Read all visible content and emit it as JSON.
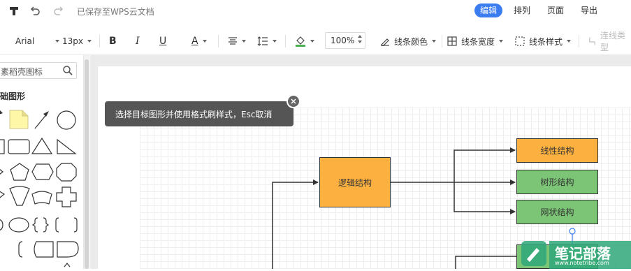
{
  "topbar": {
    "saved_status": "已保存至WPS云文档",
    "tabs": [
      {
        "label": "编辑",
        "active": true
      },
      {
        "label": "排列",
        "active": false
      },
      {
        "label": "页面",
        "active": false
      },
      {
        "label": "导出",
        "active": false
      }
    ]
  },
  "toolbar": {
    "font_family": "Arial",
    "font_size": "13px",
    "bold": "B",
    "italic": "I",
    "underline": "U",
    "font_color": "A",
    "zoom": "100%",
    "line_color": "线条颜色",
    "line_width": "线条宽度",
    "line_style": "线条样式",
    "connector_type": "连线类型"
  },
  "leftpanel": {
    "search_text": "素稻壳图标",
    "section_title": "础图形"
  },
  "canvas": {
    "tooltip": "选择目标图形并使用格式刷样式，Esc取消",
    "nodes": {
      "logic": "逻辑结构",
      "linear": "线性结构",
      "tree": "树形结构",
      "network": "网状结构"
    }
  },
  "colors": {
    "accent": "#3b7cf0",
    "node_orange": "#fbb040",
    "node_green": "#7cc576"
  },
  "watermark": {
    "title": "笔记部落",
    "url": "www.notetribe.com"
  }
}
